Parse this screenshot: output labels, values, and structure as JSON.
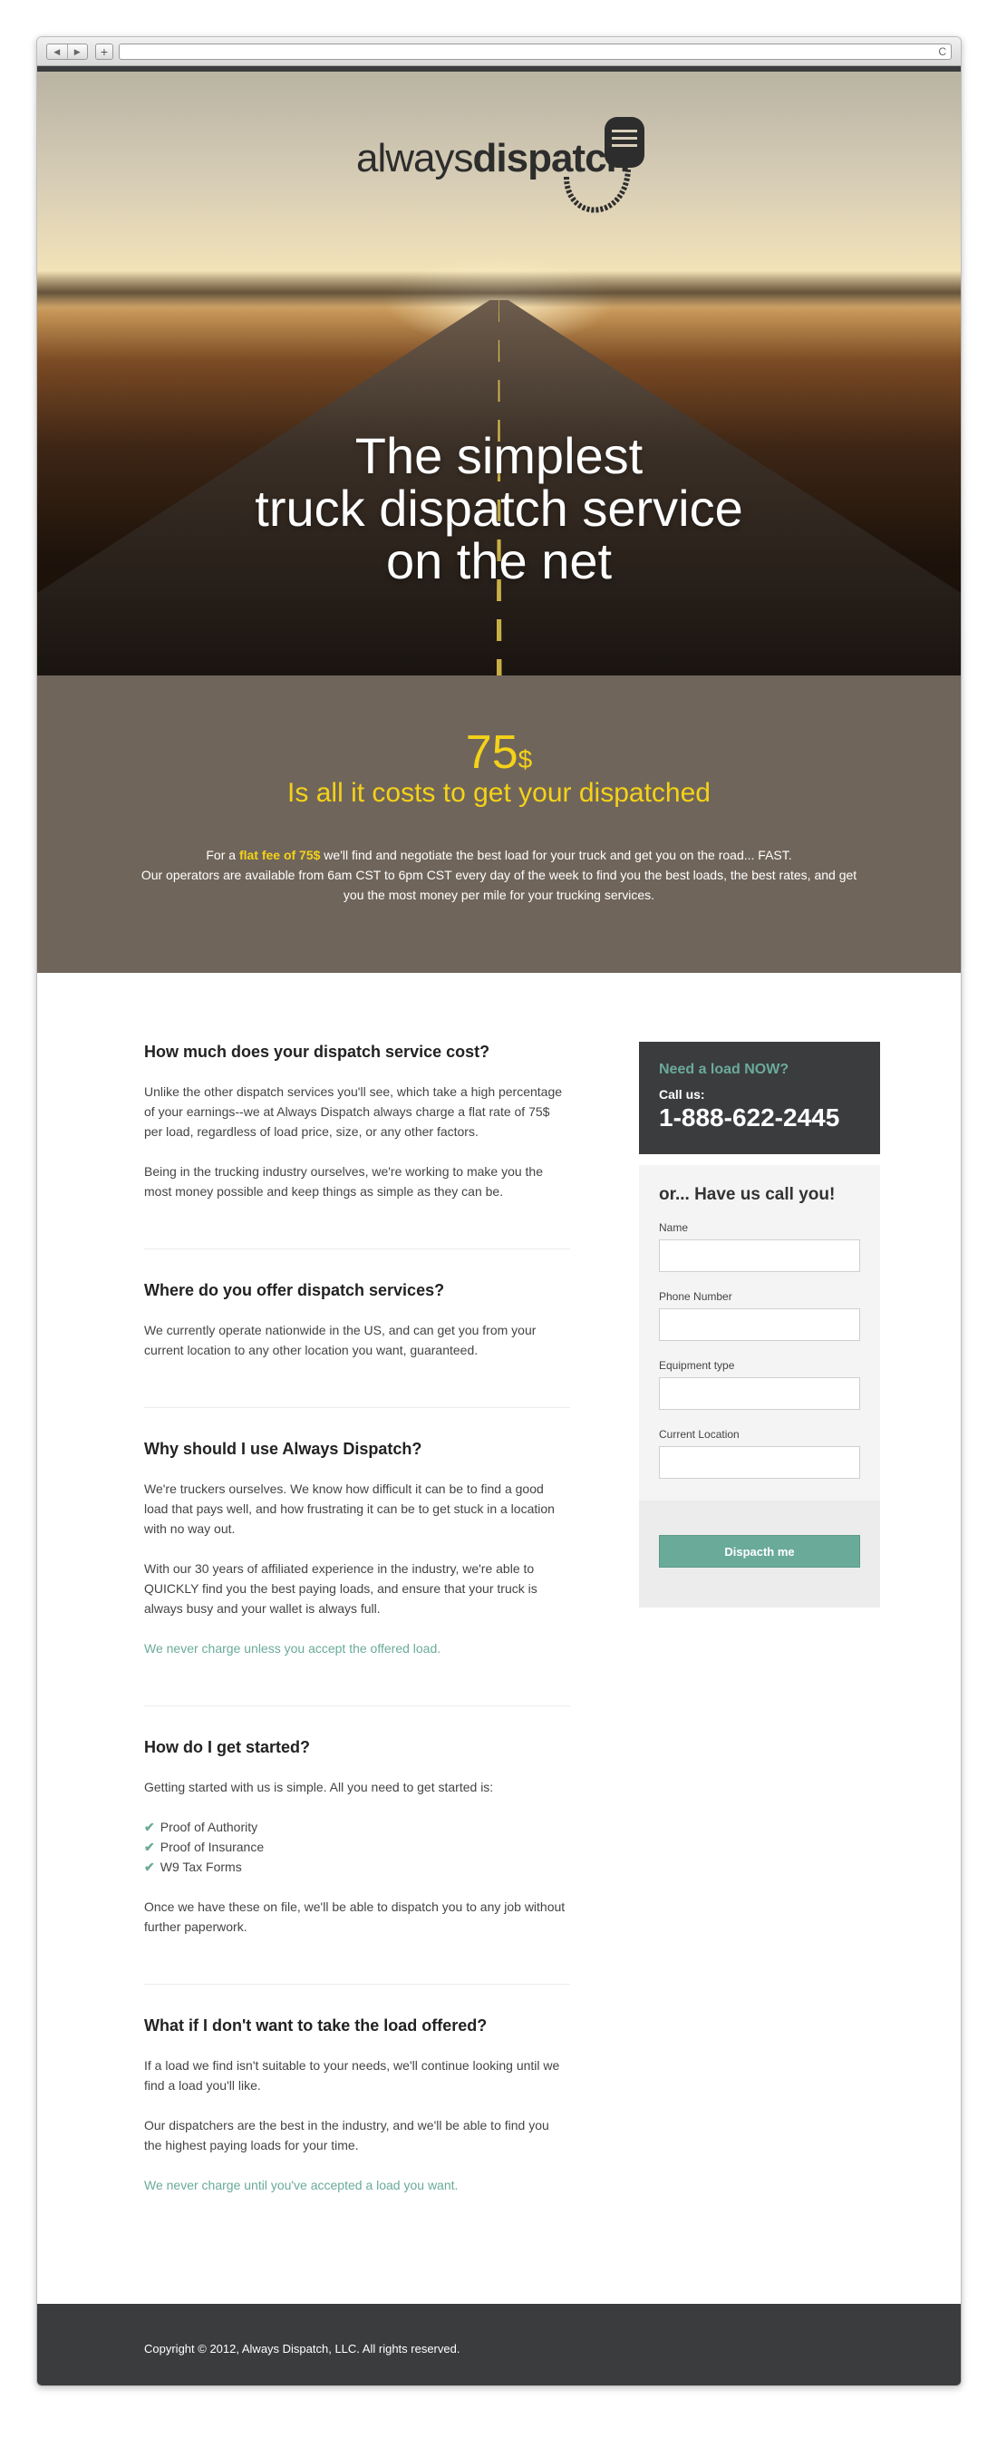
{
  "browser": {
    "back": "◀",
    "forward": "▶",
    "new_tab": "+",
    "reload": "C"
  },
  "logo": {
    "light": "always",
    "bold": "dispatch"
  },
  "hero": {
    "title_lines": [
      "The simplest",
      "truck dispatch service",
      "on the net"
    ]
  },
  "pricing": {
    "price": "75",
    "currency": "$",
    "tagline": "Is all it costs to get your dispatched",
    "desc_pre": "For a ",
    "desc_highlight": "flat fee of 75$",
    "desc_post": " we'll find and negotiate the best load for your truck and get you on the road... FAST.",
    "desc_line2": "Our operators are available from 6am CST to 6pm CST every day of the week to find you the best loads, the best rates, and get you the most money per mile for your trucking services."
  },
  "faqs": [
    {
      "title": "How much does your dispatch service cost?",
      "p1": "Unlike the other dispatch services you'll see, which take a high percentage of your earnings--we at Always Dispatch always charge a flat rate of 75$ per load, regardless of load price, size, or any other factors.",
      "p2": "Being in the trucking industry ourselves, we're working to make you the most money possible and keep things as simple as they can be."
    },
    {
      "title": "Where do you offer dispatch services?",
      "p1": "We currently operate nationwide in the US, and can get you from your current location to any other location you want, guaranteed."
    },
    {
      "title": "Why should I use Always Dispatch?",
      "p1": "We're truckers ourselves. We know how difficult it can be to find a good load that pays well, and how frustrating it can be to get stuck in a location with no way out.",
      "p2": "With our 30 years of affiliated experience in the industry, we're able to QUICKLY find you the best paying loads, and ensure that your truck is always busy and your wallet is always full.",
      "accent": "We never charge unless you accept the offered load."
    },
    {
      "title": "How do I get started?",
      "p1": "Getting started with us is simple. All you need to get started is:",
      "items": [
        "Proof of Authority",
        "Proof of Insurance",
        "W9 Tax Forms"
      ],
      "p2": "Once we have these on file, we'll be able to dispatch you to any job without further paperwork."
    },
    {
      "title": "What if I don't want to take the load offered?",
      "p1": "If a load we find isn't suitable to your needs, we'll continue looking until we find a load you'll like.",
      "p2": "Our dispatchers are the best in the industry, and we'll be able to find you the highest paying loads for your time.",
      "accent": "We never charge until you've accepted a load you want."
    }
  ],
  "sidebar": {
    "need_load": "Need a load NOW?",
    "call_us": "Call us:",
    "phone": "1-888-622-2445",
    "form_title": "or... Have us call you!",
    "fields": [
      "Name",
      "Phone Number",
      "Equipment type",
      "Current Location"
    ],
    "submit": "Dispacth me"
  },
  "footer": {
    "copyright": "Copyright © 2012, Always Dispatch, LLC. All rights reserved."
  },
  "colors": {
    "accent": "#6aaa99",
    "highlight": "#f4d219",
    "dark": "#3b3c3e",
    "band": "#70655a"
  }
}
